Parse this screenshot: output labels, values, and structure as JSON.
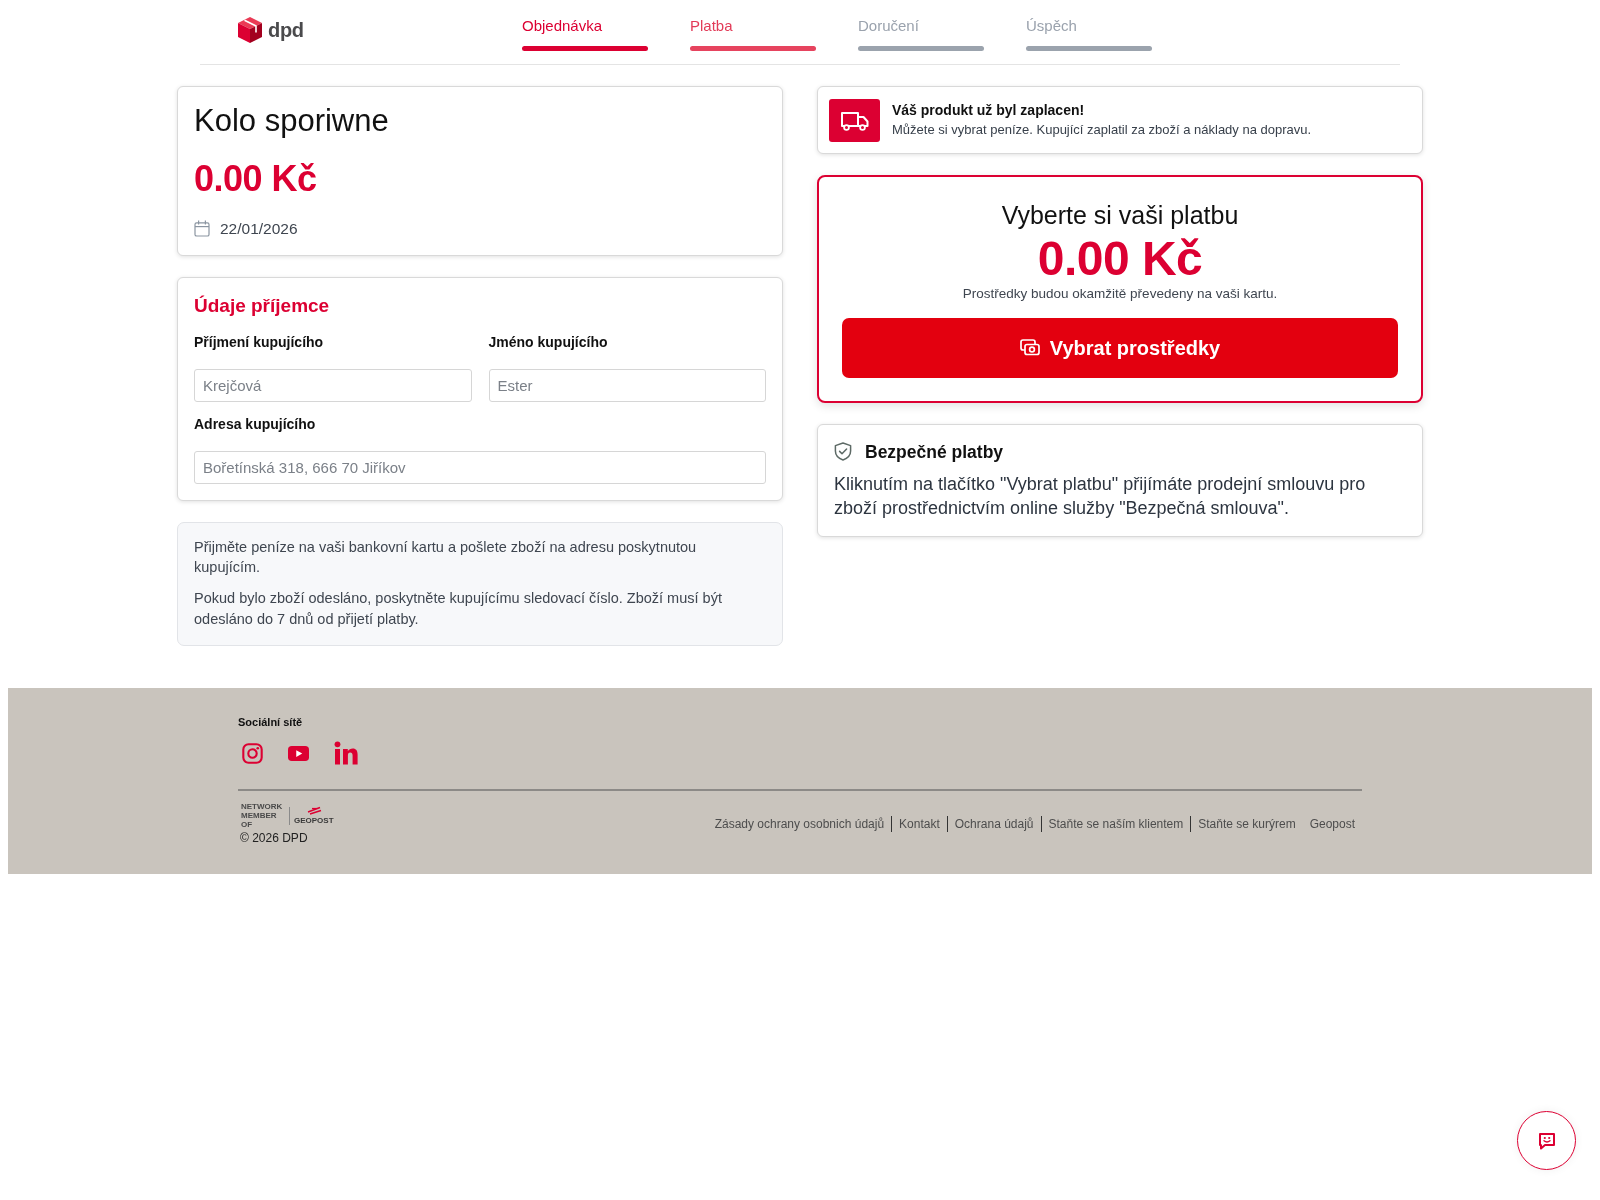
{
  "header": {
    "logo_text": "dpd",
    "steps": [
      {
        "label": "Objednávka",
        "completed": true,
        "selected": false
      },
      {
        "label": "Platba",
        "completed": false,
        "selected": true
      },
      {
        "label": "Doručení",
        "completed": false,
        "selected": false
      },
      {
        "label": "Úspěch",
        "completed": false,
        "selected": false
      }
    ]
  },
  "product": {
    "title": "Kolo sporiwne",
    "price": "0.00 Kč",
    "date": "22/01/2026"
  },
  "recipient": {
    "title": "Údaje příjemce",
    "rows": [
      {
        "fields": [
          {
            "label": "Příjmení kupujícího",
            "value": "Krejčová"
          },
          {
            "label": "Jméno kupujícího",
            "value": "Ester"
          }
        ]
      },
      {
        "fields": [
          {
            "label": "Adresa kupujícího",
            "value": "Bořetínská 318, 666 70 Jiříkov"
          }
        ]
      }
    ]
  },
  "instructions": [
    "Přijměte peníze na vaši bankovní kartu a pošlete zboží na adresu poskytnutou kupujícím.",
    "Pokud bylo zboží odesláno, poskytněte kupujícímu sledovací číslo. Zboží musí být odesláno do 7 dnů od přijetí platby."
  ],
  "notice": {
    "title": "Váš produkt už byl zaplacen!",
    "text": "Můžete si vybrat peníze. Kupující zaplatil za zboží a náklady na dopravu."
  },
  "payment": {
    "title": "Vyberte si vaši platbu",
    "amount": "0.00 Kč",
    "caption": "Prostředky budou okamžitě převedeny na vaši kartu.",
    "button": "Vybrat prostředky"
  },
  "security": {
    "title": "Bezpečné platby",
    "text": "Kliknutím na tlačítko \"Vybrat platbu\" přijímáte prodejní smlouvu pro zboží prostřednictvím online služby \"Bezpečná smlouva\"."
  },
  "footer": {
    "social_title": "Sociální sítě",
    "social": [
      {
        "kind": "instagram"
      },
      {
        "kind": "youtube"
      },
      {
        "kind": "linkedin"
      }
    ],
    "network_logo": {
      "caption": "NETWORK MEMBER OF",
      "brand": "GEOPOST"
    },
    "copyright": "© 2026 DPD",
    "links": [
      {
        "label": "Zásady ochrany osobnich údajů",
        "divider": true
      },
      {
        "label": "Kontakt",
        "divider": true
      },
      {
        "label": "Ochrana údajů",
        "divider": true
      },
      {
        "label": "Staňte se naším klientem",
        "divider": true
      },
      {
        "label": "Staňte se kurýrem",
        "divider": false
      },
      {
        "label": "Geopost",
        "divider": false
      }
    ]
  }
}
